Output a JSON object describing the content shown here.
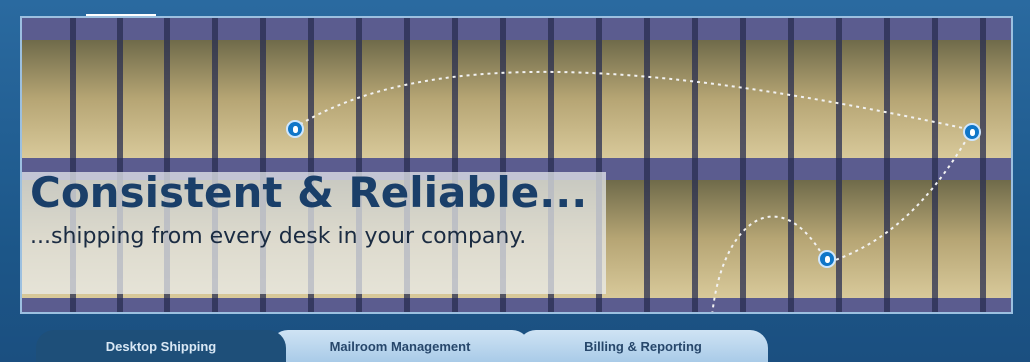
{
  "banner": {
    "headline": "Consistent & Reliable...",
    "subline": "...shipping from every desk in your company."
  },
  "tabs": [
    {
      "label": "Desktop Shipping",
      "active": true
    },
    {
      "label": "Mailroom Management",
      "active": false
    },
    {
      "label": "Billing & Reporting",
      "active": false
    }
  ],
  "colors": {
    "accent": "#1e4f79",
    "pin": "#0f76c8",
    "headline": "#1a3f69"
  },
  "icons": [
    "location-pin-icon",
    "location-pin-icon",
    "location-pin-icon"
  ]
}
